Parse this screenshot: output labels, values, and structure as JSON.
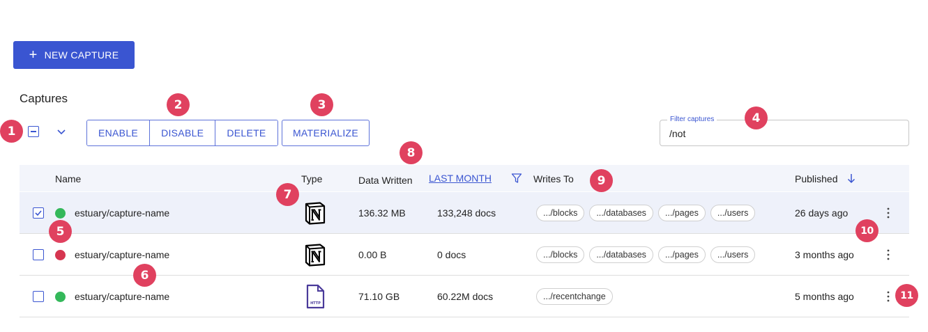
{
  "toolbar": {
    "new_capture_label": "NEW CAPTURE"
  },
  "section_title": "Captures",
  "bulk_actions": [
    "ENABLE",
    "DISABLE",
    "DELETE"
  ],
  "materialize_label": "MATERIALIZE",
  "filter": {
    "label": "Filter captures",
    "value": "/not"
  },
  "table": {
    "headers": {
      "name": "Name",
      "type": "Type",
      "data_written": "Data Written",
      "period": "LAST MONTH",
      "writes_to": "Writes To",
      "published": "Published"
    },
    "rows": [
      {
        "checked": true,
        "status": "green",
        "name": "estuary/capture-name",
        "type_icon": "notion-logo-icon",
        "data": "136.32 MB",
        "docs": "133,248 docs",
        "writes_to": [
          ".../blocks",
          ".../databases",
          ".../pages",
          ".../users"
        ],
        "published": "26 days ago"
      },
      {
        "checked": false,
        "status": "red",
        "name": "estuary/capture-name",
        "type_icon": "notion-logo-icon",
        "data": "0.00 B",
        "docs": "0 docs",
        "writes_to": [
          ".../blocks",
          ".../databases",
          ".../pages",
          ".../users"
        ],
        "published": "3 months ago"
      },
      {
        "checked": false,
        "status": "green",
        "name": "estuary/capture-name",
        "type_icon": "http-file-icon",
        "data": "71.10 GB",
        "docs": "60.22M docs",
        "writes_to": [
          ".../recentchange"
        ],
        "published": "5 months ago"
      }
    ]
  },
  "annotations": [
    "1",
    "2",
    "3",
    "4",
    "5",
    "6",
    "7",
    "8",
    "9",
    "10",
    "11"
  ],
  "colors": {
    "accent": "#3a55d1",
    "status_green": "#34b85a",
    "status_red": "#d63650",
    "badge": "#e0415f"
  }
}
